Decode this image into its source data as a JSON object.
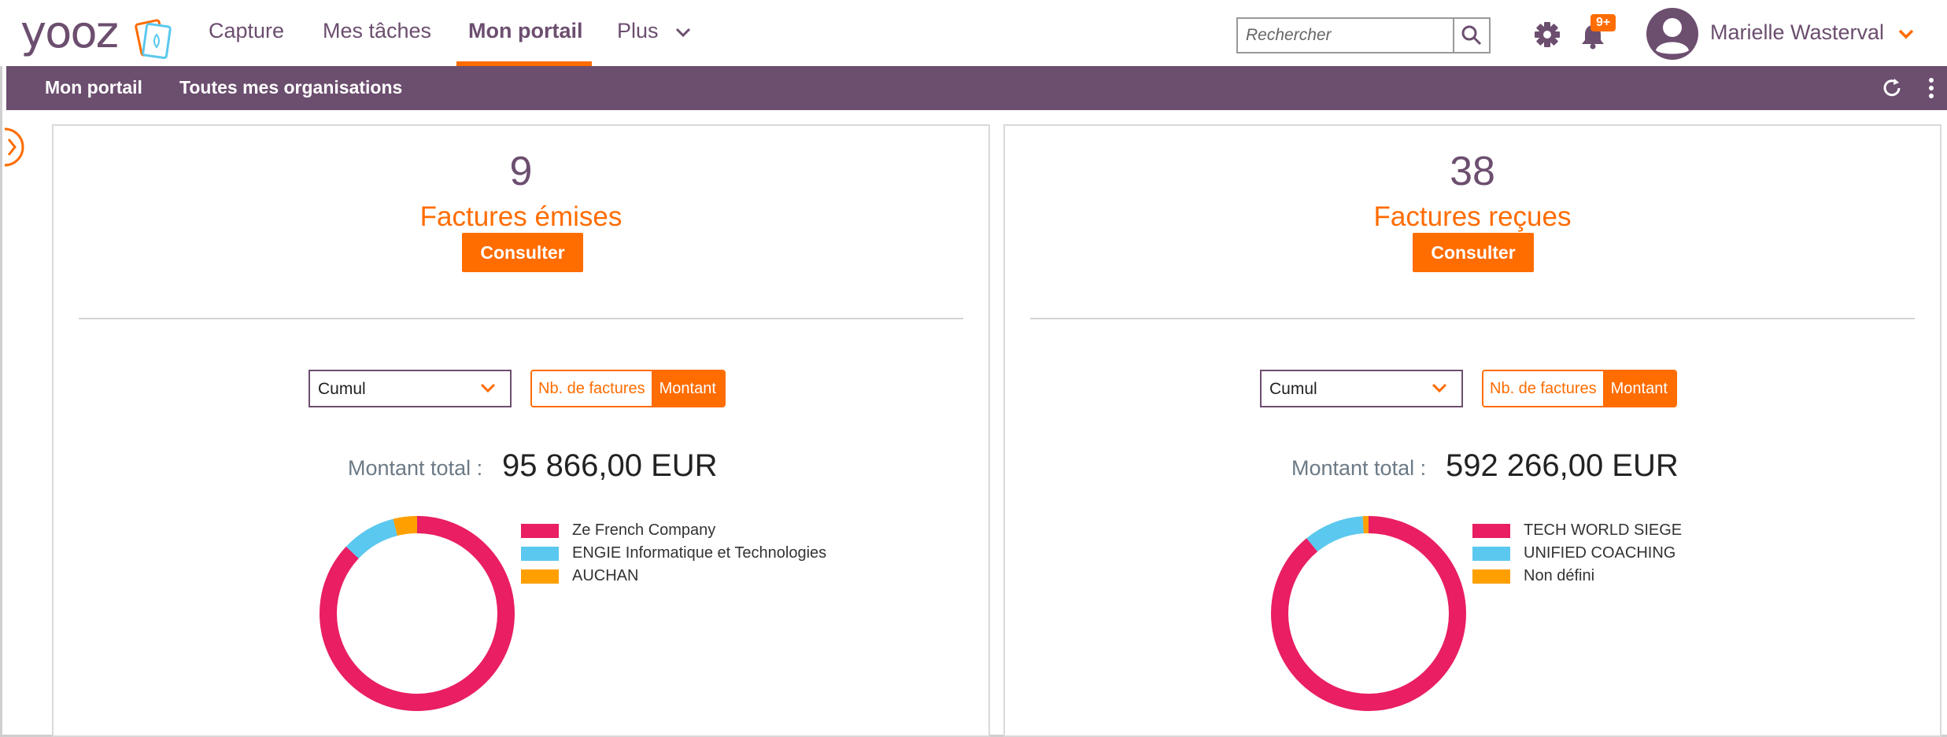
{
  "app": {
    "logo_text": "yooz"
  },
  "nav": {
    "items": [
      "Capture",
      "Mes tâches",
      "Mon portail",
      "Plus"
    ]
  },
  "search": {
    "placeholder": "Rechercher"
  },
  "notifications": {
    "badge": "9+"
  },
  "user": {
    "name": "Marielle Wasterval"
  },
  "subnav": {
    "items": [
      "Mon portail",
      "Toutes mes organisations"
    ]
  },
  "colors": {
    "brand_purple": "#6c4e6f",
    "brand_orange": "#ff6c00",
    "series_pink": "#e91e63",
    "series_blue": "#5bc8ef",
    "series_amber": "#ff9f00"
  },
  "panels": [
    {
      "count": "9",
      "title": "Factures émises",
      "consult_label": "Consulter",
      "period_select": "Cumul",
      "toggle_options": [
        "Nb. de factures",
        "Montant"
      ],
      "toggle_selected": "Montant",
      "total_label": "Montant total :",
      "total_value": "95 866,00 EUR",
      "legend": [
        "Ze French Company",
        "ENGIE Informatique et Technologies",
        "AUCHAN"
      ],
      "shares": [
        0.87,
        0.09,
        0.04
      ]
    },
    {
      "count": "38",
      "title": "Factures reçues",
      "consult_label": "Consulter",
      "period_select": "Cumul",
      "toggle_options": [
        "Nb. de factures",
        "Montant"
      ],
      "toggle_selected": "Montant",
      "total_label": "Montant total :",
      "total_value": "592 266,00 EUR",
      "legend": [
        "TECH WORLD SIEGE",
        "UNIFIED COACHING",
        "Non défini"
      ],
      "shares": [
        0.89,
        0.1,
        0.01
      ]
    }
  ]
}
